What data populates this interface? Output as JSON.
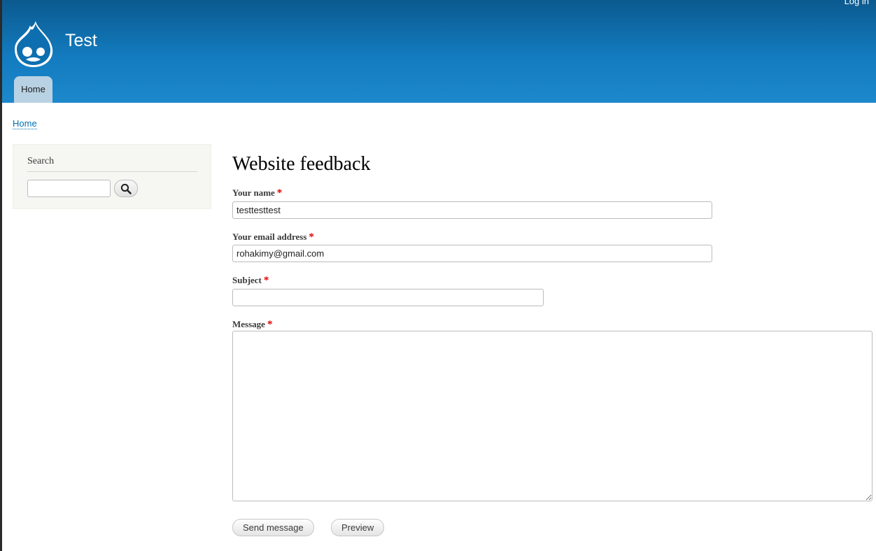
{
  "header": {
    "site_name": "Test",
    "login_label": "Log in",
    "main_menu": [
      {
        "label": "Home",
        "active": true
      }
    ]
  },
  "breadcrumb": {
    "items": [
      "Home"
    ]
  },
  "sidebar": {
    "search_block": {
      "title": "Search",
      "input_value": "",
      "button_icon": "magnifier-icon"
    }
  },
  "main": {
    "title": "Website feedback",
    "form": {
      "name_label": "Your name",
      "name_value": "testtesttest",
      "email_label": "Your email address",
      "email_value": "rohakimy@gmail.com",
      "subject_label": "Subject",
      "subject_value": "",
      "message_label": "Message",
      "message_value": "",
      "required_marker": "*",
      "send_label": "Send message",
      "preview_label": "Preview"
    }
  },
  "colors": {
    "header_top": "#0b5a8f",
    "header_bottom": "#1d88cc",
    "link": "#0071b3",
    "required": "#e30000",
    "tab_active": "#b9d2e3",
    "sidebar_bg": "#f6f6f2"
  }
}
